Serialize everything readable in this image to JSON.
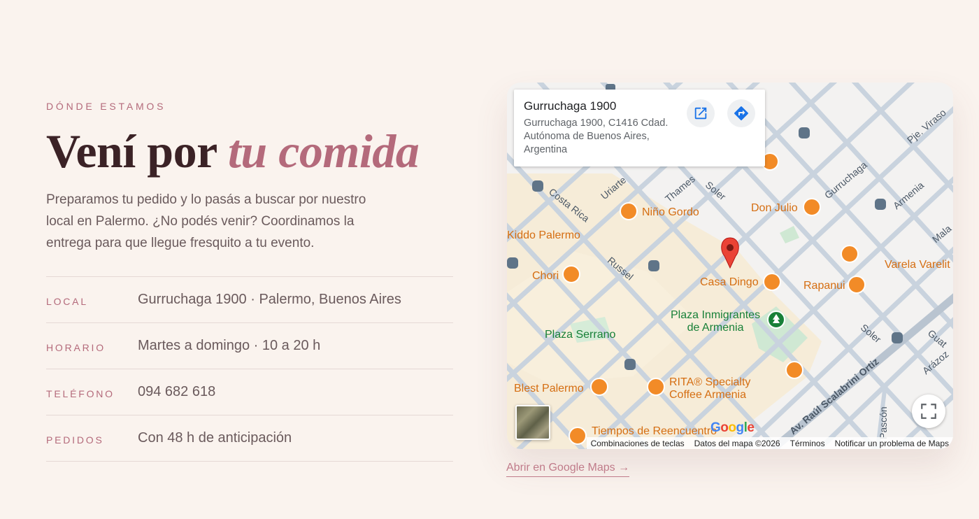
{
  "section": {
    "eyebrow": "DÓNDE ESTAMOS",
    "headline_plain": "Vení por ",
    "headline_accent": "tu comida",
    "intro": "Preparamos tu pedido y lo pasás a buscar por nuestro local en Palermo. ¿No podés venir? Coordinamos la entrega para que llegue fresquito a tu evento."
  },
  "details": [
    {
      "label": "LOCAL",
      "value": "Gurruchaga 1900 · Palermo, Buenos Aires"
    },
    {
      "label": "HORARIO",
      "value": "Martes a domingo · 10 a 20 h"
    },
    {
      "label": "TELÉFONO",
      "value": "094 682 618"
    },
    {
      "label": "PEDIDOS",
      "value": "Con 48 h de anticipación"
    }
  ],
  "map": {
    "place_title": "Gurruchaga 1900",
    "place_address": "Gurruchaga 1900, C1416 Cdad. Autónoma de Buenos Aires, Argentina",
    "pois": {
      "nino_gordo": "Niño Gordo",
      "don_julio": "Don Julio",
      "kiddo": "Kiddo Palermo",
      "chori": "Chori",
      "casa_dingo": "Casa Dingo",
      "rapanui": "Rapanui",
      "varela": "Varela Varelit",
      "plaza_inmigrantes_1": "Plaza Inmigrantes",
      "plaza_inmigrantes_2": "de Armenia",
      "plaza_serrano": "Plaza Serrano",
      "blest": "Blest Palermo",
      "rita_1": "RITA® Specialty",
      "rita_2": "Coffee Armenia",
      "tiempos": "Tiempos de Reencuentro"
    },
    "streets": {
      "costa_rica": "Costa Rica",
      "uriarte": "Uriarte",
      "thames": "Thames",
      "soler": "Soler",
      "gurruchaga": "Gurruchaga",
      "armenia": "Armenia",
      "pje_virasoro": "Pje. Viraso",
      "malabia": "Mala",
      "russel": "Russel",
      "soler2": "Soler",
      "guatemala": "Guat",
      "arazoza": "Arázoz",
      "scalabrini": "Av. Raúl Scalabrini Ortiz",
      "pascon": "Pascón"
    },
    "google_logo": {
      "letters": [
        "G",
        "o",
        "o",
        "g",
        "l",
        "e"
      ],
      "colors": [
        "#4285F4",
        "#EA4335",
        "#FBBC05",
        "#4285F4",
        "#34A853",
        "#EA4335"
      ]
    },
    "attribution": {
      "shortcuts": "Combinaciones de teclas",
      "data": "Datos del mapa ©2026",
      "terms": "Términos",
      "report": "Notificar un problema de Maps"
    },
    "colors": {
      "pin_red": "#ea4335",
      "poi_orange": "#f28b27",
      "park_green": "#188038",
      "road": "#c9d3de",
      "land_tan": "#f6ecd8",
      "button_blue": "#1a73e8"
    }
  },
  "link": {
    "open_maps": "Abrir en Google Maps →"
  }
}
